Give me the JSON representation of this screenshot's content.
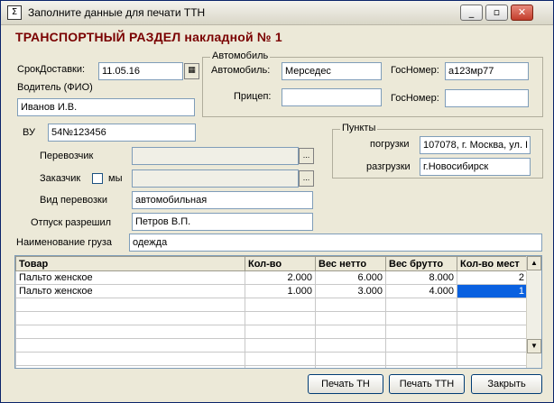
{
  "window": {
    "title": "Заполните данные для печати ТТН",
    "icon_glyph": "Σ",
    "controls": {
      "minimize": "_",
      "maximize": "▫",
      "close": "✕"
    }
  },
  "heading": "ТРАНСПОРТНЫЙ РАЗДЕЛ накладной № 1",
  "delivery": {
    "label": "СрокДоставки:",
    "value": "11.05.16",
    "calendar_icon": "▦"
  },
  "driver": {
    "label": "Водитель (ФИО)",
    "value": "Иванов И.В."
  },
  "license": {
    "label": "ВУ",
    "value": "54№123456"
  },
  "vehicle": {
    "group_title": "Автомобиль",
    "car_label": "Автомобиль:",
    "car_value": "Мерседес",
    "plate_label": "ГосНомер:",
    "plate_value": "а123мр77",
    "trailer_label": "Прицеп:",
    "trailer_value": "",
    "trailer_plate_label": "ГосНомер:",
    "trailer_plate_value": ""
  },
  "points": {
    "group_title": "Пункты",
    "loading_label": "погрузки",
    "loading_value": "107078, г. Москва, ул. I",
    "unloading_label": "разгрузки",
    "unloading_value": "г.Новосибирск"
  },
  "carrier": {
    "label": "Перевозчик",
    "value": "",
    "dots": "..."
  },
  "customer": {
    "label": "Заказчик",
    "self_label": "мы",
    "value": "",
    "dots": "..."
  },
  "transport_type": {
    "label": "Вид перевозки",
    "value": "автомобильная"
  },
  "release": {
    "label": "Отпуск разрешил",
    "value": "Петров В.П."
  },
  "cargo": {
    "label": "Наименование груза",
    "value": "одежда"
  },
  "table": {
    "columns": [
      "Товар",
      "Кол-во",
      "Вес нетто",
      "Вес брутто",
      "Кол-во мест"
    ],
    "rows": [
      [
        "Пальто женское",
        "2.000",
        "6.000",
        "8.000",
        "2"
      ],
      [
        "Пальто женское",
        "1.000",
        "3.000",
        "4.000",
        "1"
      ]
    ],
    "scroll_up": "▲",
    "scroll_down": "▼"
  },
  "buttons": {
    "print_tn": "Печать ТН",
    "print_ttn": "Печать ТТН",
    "close": "Закрыть"
  }
}
